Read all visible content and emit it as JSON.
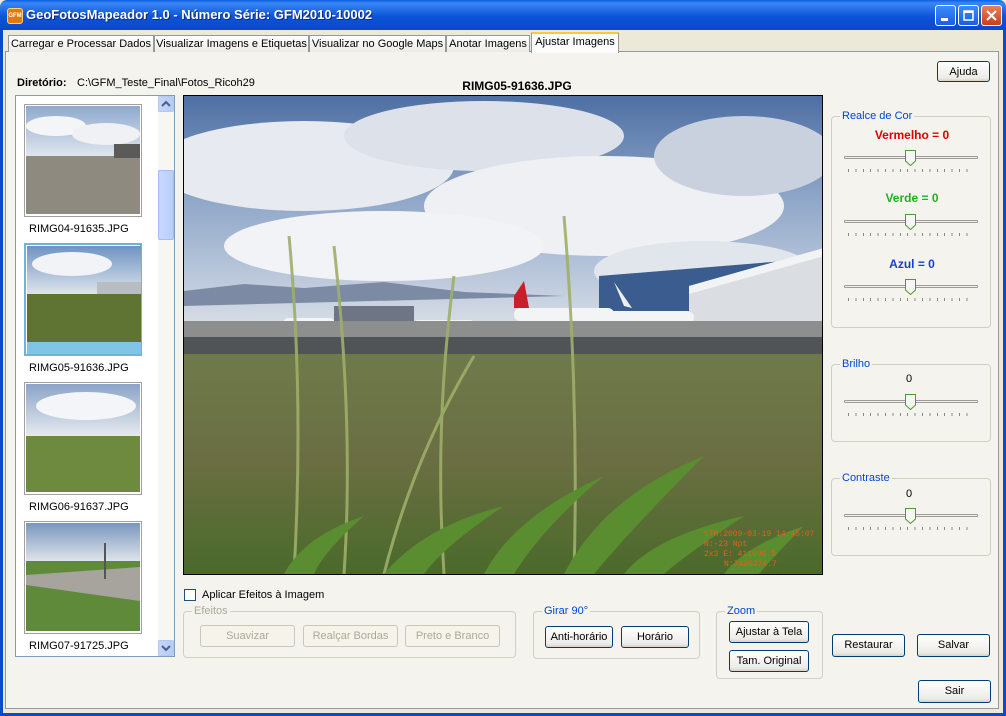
{
  "window": {
    "title": "GeoFotosMapeador 1.0 - Número Série: GFM2010-10002",
    "app_icon_text": "GFM"
  },
  "tabs": [
    {
      "label": "Carregar e Processar Dados"
    },
    {
      "label": "Visualizar Imagens e Etiquetas"
    },
    {
      "label": "Visualizar no Google Maps"
    },
    {
      "label": "Anotar Imagens"
    },
    {
      "label": "Ajustar Imagens",
      "active": true
    }
  ],
  "directory": {
    "label": "Diretório:",
    "value": "C:\\GFM_Teste_Final\\Fotos_Ricoh29"
  },
  "image": {
    "filename": "RIMG05-91636.JPG",
    "overlay": [
      "STM:2009-03-19 14:45:07",
      "N:-23 Npt",
      "2x3 E: 411696.5",
      "N:7405274.7"
    ]
  },
  "thumbnails": [
    {
      "label": "RIMG04-91635.JPG"
    },
    {
      "label": "RIMG05-91636.JPG",
      "selected": true
    },
    {
      "label": "RIMG06-91637.JPG"
    },
    {
      "label": "RIMG07-91725.JPG"
    }
  ],
  "help_button": "Ajuda",
  "color_enhance": {
    "title": "Realce de Cor",
    "red_label": "Vermelho = 0",
    "green_label": "Verde = 0",
    "blue_label": "Azul = 0",
    "red_value": 0,
    "green_value": 0,
    "blue_value": 0,
    "colors": {
      "red": "#E00000",
      "green": "#1FB31F",
      "blue": "#1A3FC8"
    }
  },
  "brightness": {
    "title": "Brilho",
    "value": "0"
  },
  "contrast": {
    "title": "Contraste",
    "value": "0"
  },
  "apply_effects": {
    "label": "Aplicar Efeitos à Imagem",
    "checked": false
  },
  "effects": {
    "title": "Efeitos",
    "smooth": "Suavizar",
    "edges": "Realçar Bordas",
    "bw": "Preto e Branco"
  },
  "rotate": {
    "title": "Girar 90°",
    "ccw": "Anti-horário",
    "cw": "Horário"
  },
  "zoom": {
    "title": "Zoom",
    "fit": "Ajustar à Tela",
    "original": "Tam. Original"
  },
  "actions": {
    "restore": "Restaurar",
    "save": "Salvar",
    "exit": "Sair"
  }
}
